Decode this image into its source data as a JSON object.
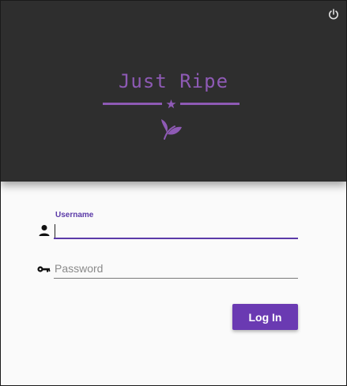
{
  "app": {
    "title": "Just Ripe"
  },
  "header": {
    "background_color": "#2e2e2e",
    "accent_color": "#8e5ab5",
    "power_icon": "power-icon",
    "divider_icon": "star-icon",
    "logo_icon": "leaf-icon"
  },
  "form": {
    "username": {
      "label": "Username",
      "value": "",
      "placeholder": "",
      "icon": "person-icon",
      "focused": true
    },
    "password": {
      "label": "",
      "value": "",
      "placeholder": "Password",
      "icon": "key-icon"
    },
    "login_button": {
      "label": "Log In",
      "color": "#6a3ab2"
    }
  }
}
